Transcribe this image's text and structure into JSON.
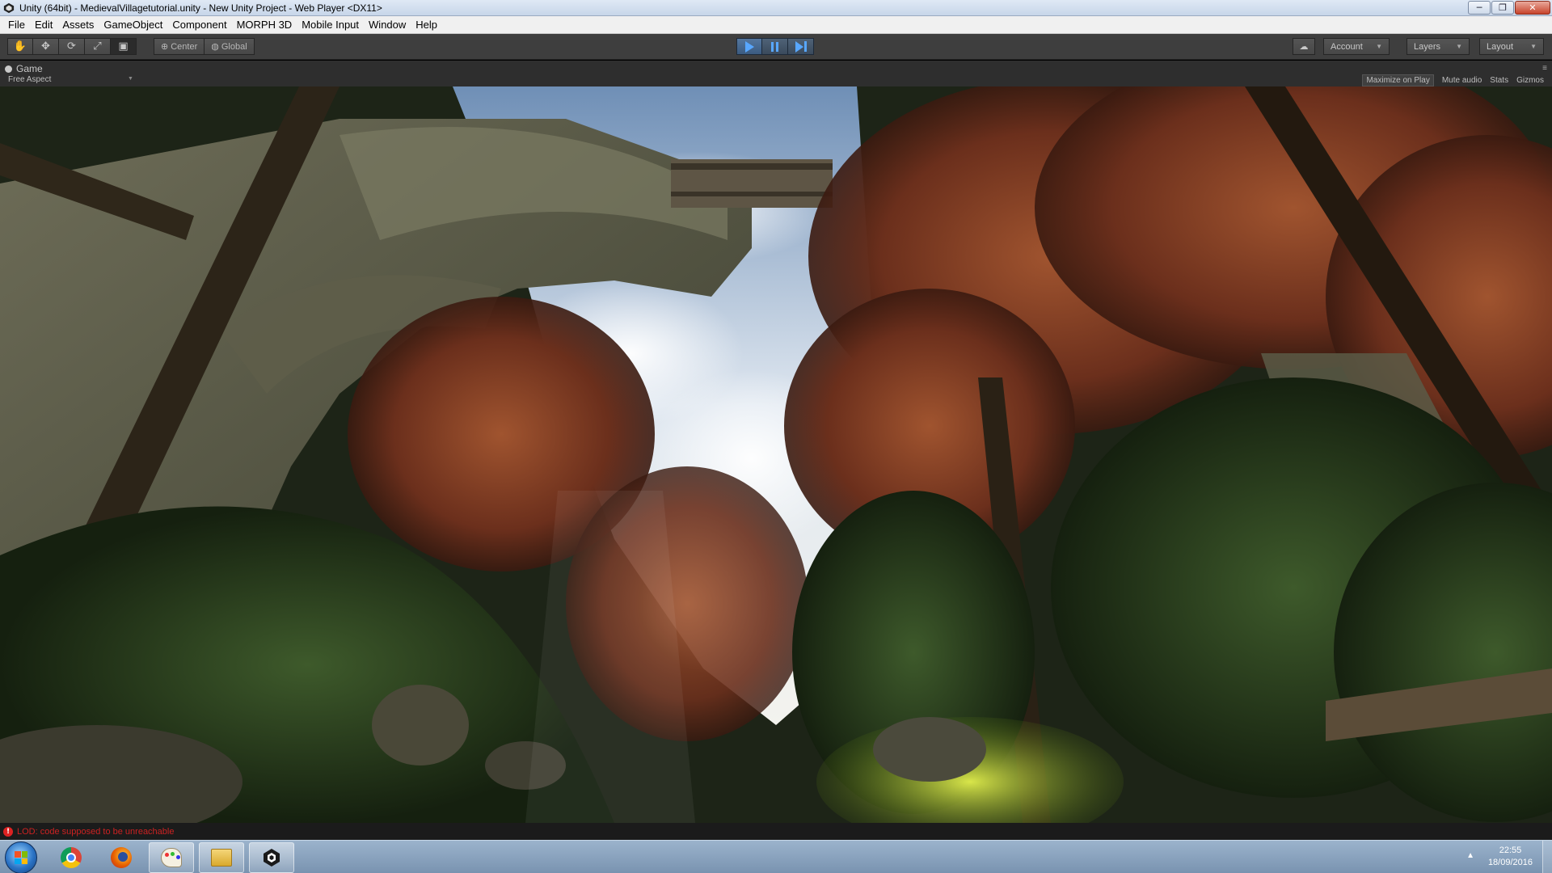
{
  "window": {
    "title": "Unity (64bit) - MedievalVillagetutorial.unity - New Unity Project - Web Player <DX11>",
    "controls": {
      "minimize": "─",
      "maximize": "❐",
      "close": "✕"
    }
  },
  "menu": [
    "File",
    "Edit",
    "Assets",
    "GameObject",
    "Component",
    "MORPH 3D",
    "Mobile Input",
    "Window",
    "Help"
  ],
  "toolbar": {
    "transform_tools": [
      {
        "icon": "hand-icon",
        "glyph": "✋"
      },
      {
        "icon": "move-icon",
        "glyph": "✥"
      },
      {
        "icon": "rotate-icon",
        "glyph": "⟳"
      },
      {
        "icon": "scale-icon",
        "glyph": "⤢"
      },
      {
        "icon": "rect-tool-icon",
        "glyph": "▣"
      }
    ],
    "pivot_label": "Center",
    "space_label": "Global",
    "play_state": "playing",
    "account_label": "Account",
    "layers_label": "Layers",
    "layout_label": "Layout",
    "accent_color": "#58a7ff"
  },
  "game_view": {
    "tab_label": "Game",
    "aspect_label": "Free Aspect",
    "options": [
      "Maximize on Play",
      "Mute audio",
      "Stats",
      "Gizmos"
    ]
  },
  "console": {
    "message": "LOD: code supposed to be unreachable",
    "error_color": "#cc2222"
  },
  "taskbar": {
    "apps": [
      "chrome-icon",
      "firefox-icon",
      "paint-icon",
      "explorer-folder-icon",
      "unity-icon"
    ],
    "clock_time": "22:55",
    "clock_date": "18/09/2016"
  }
}
